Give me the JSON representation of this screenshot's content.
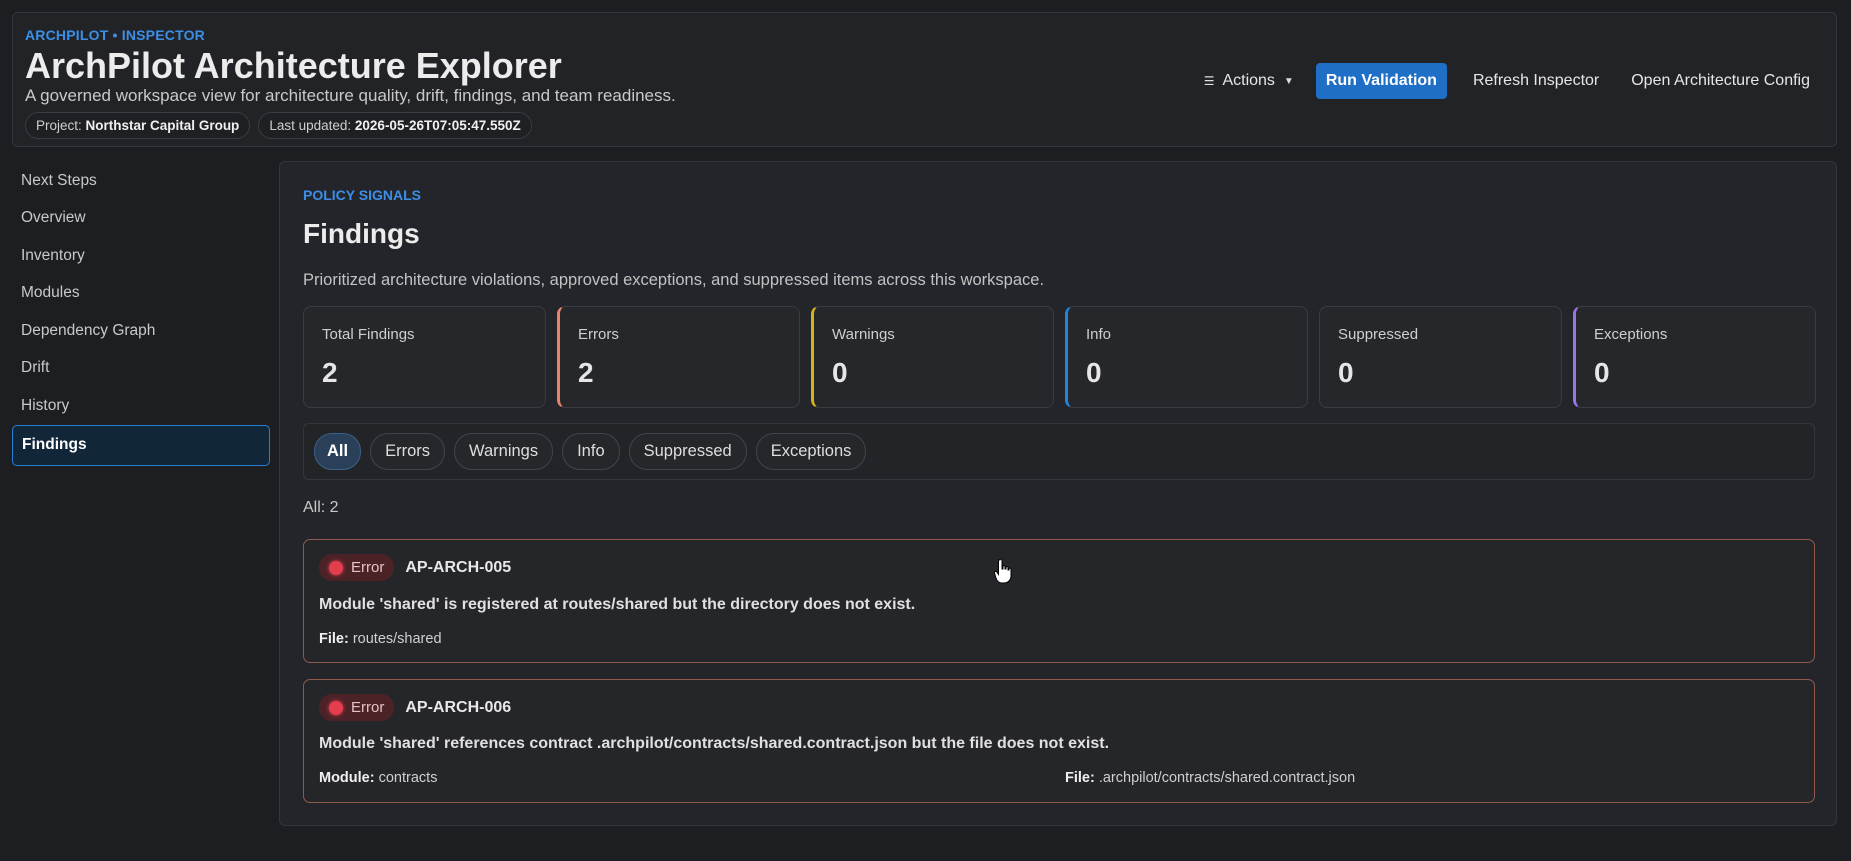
{
  "header": {
    "eyebrow": "ARCHPILOT • INSPECTOR",
    "title": "ArchPilot Architecture Explorer",
    "subtitle": "A governed workspace view for architecture quality, drift, findings, and team readiness.",
    "project_label": "Project:",
    "project_value": "Northstar Capital Group",
    "updated_label": "Last updated:",
    "updated_value": "2026-05-26T07:05:47.550Z",
    "actions_label": "Actions",
    "run_validation": "Run Validation",
    "refresh_inspector": "Refresh Inspector",
    "open_config": "Open Architecture Config"
  },
  "sidebar": {
    "items": [
      {
        "label": "Next Steps"
      },
      {
        "label": "Overview"
      },
      {
        "label": "Inventory"
      },
      {
        "label": "Modules"
      },
      {
        "label": "Dependency Graph"
      },
      {
        "label": "Drift"
      },
      {
        "label": "History"
      },
      {
        "label": "Findings",
        "active": true
      }
    ]
  },
  "main": {
    "eyebrow": "POLICY SIGNALS",
    "title": "Findings",
    "description": "Prioritized architecture violations, approved exceptions, and suppressed items across this workspace.",
    "stats": [
      {
        "label": "Total Findings",
        "value": "2",
        "accent": null
      },
      {
        "label": "Errors",
        "value": "2",
        "accent": "#e8826e"
      },
      {
        "label": "Warnings",
        "value": "0",
        "accent": "#d6b21c"
      },
      {
        "label": "Info",
        "value": "0",
        "accent": "#1e86de"
      },
      {
        "label": "Suppressed",
        "value": "0",
        "accent": null
      },
      {
        "label": "Exceptions",
        "value": "0",
        "accent": "#9a74e8"
      }
    ],
    "filters": [
      "All",
      "Errors",
      "Warnings",
      "Info",
      "Suppressed",
      "Exceptions"
    ],
    "active_filter": "All",
    "count_line": "All: 2",
    "findings": [
      {
        "severity": "Error",
        "rule_id": "AP-ARCH-005",
        "message": "Module 'shared' is registered at routes/shared but the directory does not exist.",
        "file_label": "File:",
        "file_value": "routes/shared"
      },
      {
        "severity": "Error",
        "rule_id": "AP-ARCH-006",
        "message": "Module 'shared' references contract .archpilot/contracts/shared.contract.json but the file does not exist.",
        "module_label": "Module:",
        "module_value": "contracts",
        "file_label": "File:",
        "file_value": ".archpilot/contracts/shared.contract.json"
      }
    ]
  },
  "colors": {
    "accent_blue": "#3b8fe8",
    "primary_button": "#1f6fc7",
    "error_dot": "#e43d4e",
    "card_border": "#8f5a4c"
  },
  "icons": {
    "actions": "filter-lines-icon",
    "chevron": "chevron-down-icon",
    "severity": "error-dot-icon",
    "cursor": "hand-pointer-icon"
  }
}
